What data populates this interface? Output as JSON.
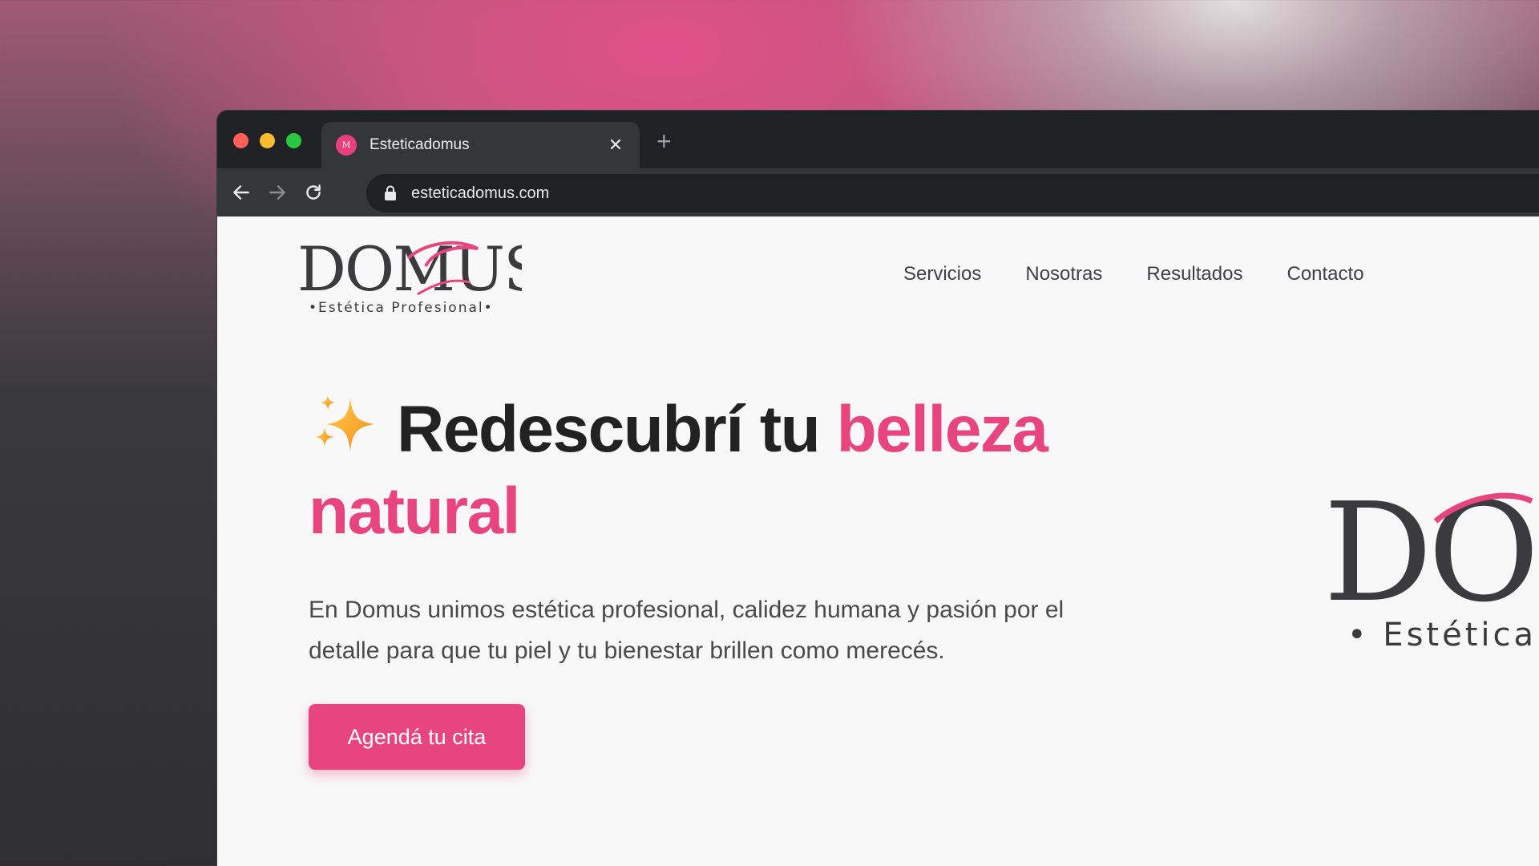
{
  "browser": {
    "tab_title": "Esteticadomus",
    "favicon_text": "M",
    "url": "esteticadomus.com",
    "new_tab_symbol": "+",
    "close_symbol": "✕"
  },
  "site": {
    "logo_text": "DOMUS",
    "logo_tagline": "•Estética Profesional•",
    "nav": [
      "Servicios",
      "Nosotras",
      "Resultados",
      "Contacto"
    ],
    "hero": {
      "title_part1": "Redescubrí tu ",
      "title_highlight": "belleza natural",
      "paragraph": "En Domus unimos estética profesional, calidez humana y pasión por el detalle para que tu piel y tu bienestar brillen como merecés.",
      "cta": "Agendá tu cita"
    },
    "side_logo_tagline": "• Estética",
    "colors": {
      "accent": "#e8457f",
      "text_dark": "#222222"
    }
  }
}
